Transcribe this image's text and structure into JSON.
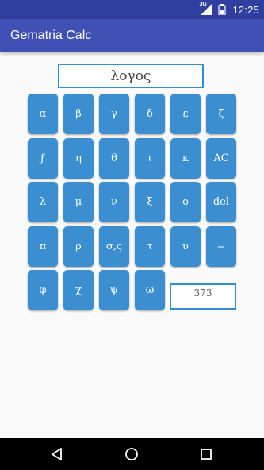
{
  "status_bar": {
    "network_label": "3G",
    "time": "12:25"
  },
  "app_bar": {
    "title": "Gematria Calc"
  },
  "input": {
    "value": "λογος"
  },
  "keys": [
    [
      "α",
      "β",
      "γ",
      "δ",
      "ε",
      "ζ"
    ],
    [
      "ϝ",
      "η",
      "θ",
      "ι",
      "κ",
      "AC"
    ],
    [
      "λ",
      "μ",
      "ν",
      "ξ",
      "ο",
      "del"
    ],
    [
      "π",
      "ρ",
      "σ,ς",
      "τ",
      "υ",
      "="
    ],
    [
      "φ",
      "χ",
      "ψ",
      "ω"
    ]
  ],
  "result": {
    "value": "373"
  },
  "nav": {
    "back_icon": "back-triangle-icon",
    "home_icon": "home-circle-icon",
    "recents_icon": "recents-square-icon"
  }
}
